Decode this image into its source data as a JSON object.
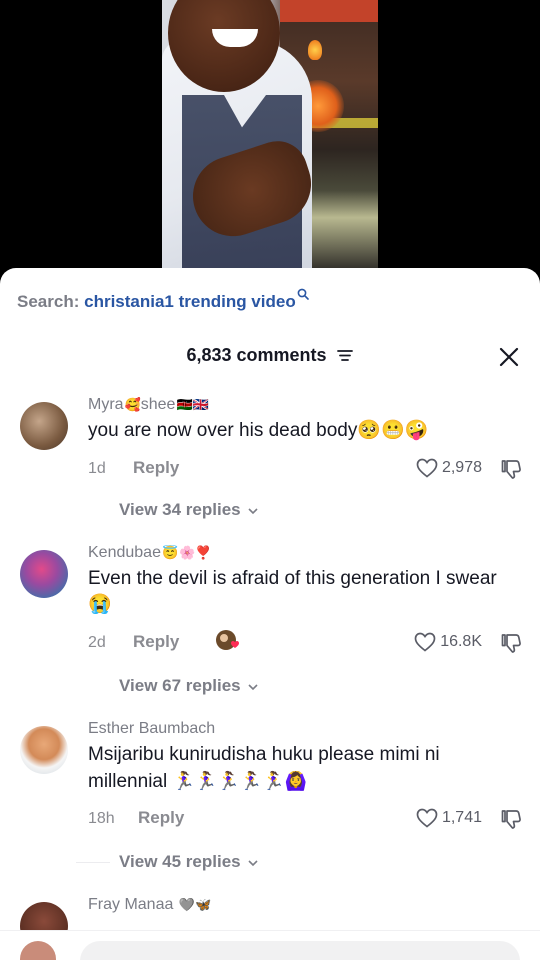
{
  "search": {
    "label": "Search:",
    "term": "christania1 trending video"
  },
  "header": {
    "count_text": "6,833 comments"
  },
  "comments": [
    {
      "name": "Myra",
      "name_emoji_1": "🥰",
      "name_suffix": "shee",
      "name_emoji_2": "🇰🇪🇬🇧",
      "text": "you are now over his dead body🥺😬🤪",
      "age": "1d",
      "reply_label": "Reply",
      "likes": "2,978",
      "view_replies": "View 34 replies"
    },
    {
      "name": "Kendubae",
      "name_emoji_1": "😇",
      "name_emoji_2": "🌸❣️",
      "text": "Even the devil is afraid of this generation I swear 😭",
      "age": "2d",
      "reply_label": "Reply",
      "likes": "16.8K",
      "view_replies": "View 67 replies"
    },
    {
      "name": "Esther Baumbach",
      "text": "Msijaribu kunirudisha huku please mimi ni millennial",
      "text_emoji": "🏃‍♀️🏃‍♀️🏃‍♀️🏃‍♀️🏃‍♀️🙆‍♀️",
      "age": "18h",
      "reply_label": "Reply",
      "likes": "1,741",
      "view_replies": "View 45 replies"
    },
    {
      "name": "Fray Manaa",
      "name_emoji_1": "🩶🦋"
    }
  ],
  "colors": {
    "accent_blue": "#2a56a3",
    "muted": "#7b7d86",
    "text": "#161823"
  }
}
